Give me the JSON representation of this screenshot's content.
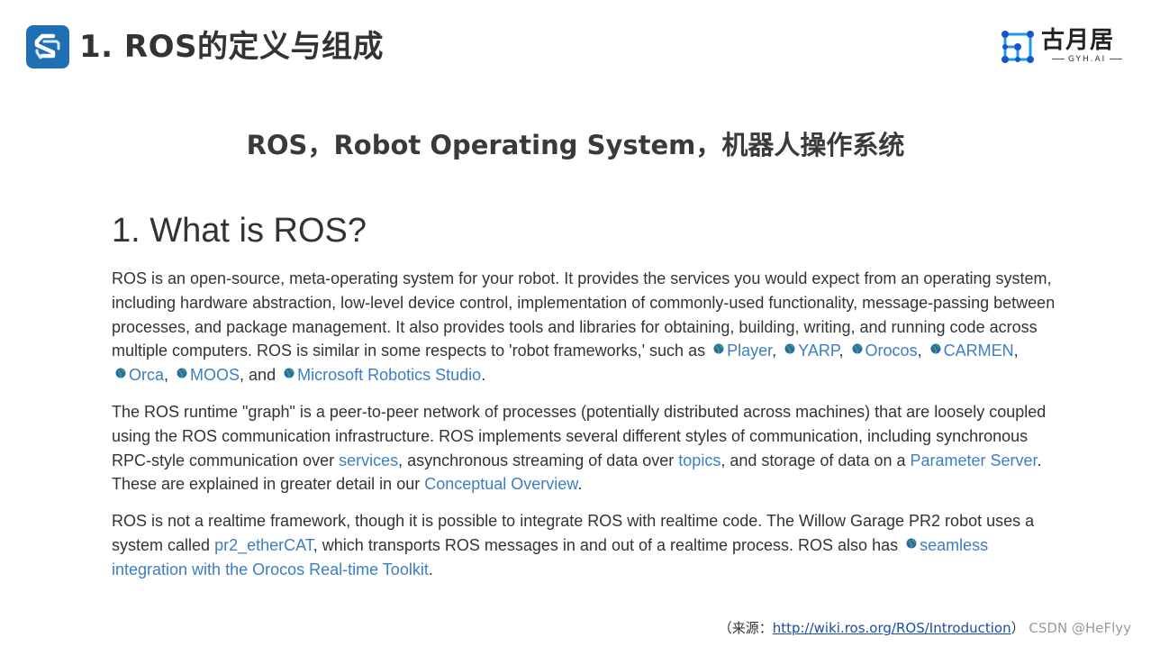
{
  "header": {
    "title": "1. ROS的定义与组成",
    "brand_name": "古月居",
    "brand_sub": "GYH.AI"
  },
  "subtitle": "ROS，Robot Operating System，机器人操作系统",
  "wiki": {
    "heading": "1. What is ROS?",
    "p1": {
      "t1": "ROS is an open-source, meta-operating system for your robot. It provides the services you would expect from an operating system, including hardware abstraction, low-level device control, implementation of commonly-used functionality, message-passing between processes, and package management. It also provides tools and libraries for obtaining, building, writing, and running code across multiple computers. ROS is similar in some respects to 'robot frameworks,' such as",
      "link_player": "Player",
      "link_yarp": "YARP",
      "link_orocos": "Orocos",
      "link_carmen": "CARMEN",
      "link_orca": "Orca",
      "link_moos": "MOOS",
      "and_text": ", and",
      "link_msrs": "Microsoft Robotics Studio",
      "end": "."
    },
    "p2": {
      "t1": "The ROS runtime \"graph\" is a peer-to-peer network of processes (potentially distributed across machines) that are loosely coupled using the ROS communication infrastructure. ROS implements several different styles of communication, including synchronous RPC-style communication over",
      "link_services": "services",
      "t2": ", asynchronous streaming of data over",
      "link_topics": "topics",
      "t3": ", and storage of data on a",
      "link_param": "Parameter Server",
      "t4": ". These are explained in greater detail in our",
      "link_concept": "Conceptual Overview",
      "end": "."
    },
    "p3": {
      "t1": "ROS is not a realtime framework, though it is possible to integrate ROS with realtime code. The Willow Garage PR2 robot uses a system called",
      "link_ethercat": "pr2_etherCAT",
      "t2": ", which transports ROS messages in and out of a realtime process. ROS also has",
      "link_seamless": "seamless integration with the Orocos Real-time Toolkit",
      "end": "."
    }
  },
  "source": {
    "prefix": "（来源：",
    "url": "http://wiki.ros.org/ROS/Introduction",
    "suffix": "）",
    "watermark": "CSDN @HeFlyy"
  },
  "colors": {
    "logo_blue": "#1f6fb5",
    "link_blue": "#3c7ec3",
    "text": "#333333"
  }
}
